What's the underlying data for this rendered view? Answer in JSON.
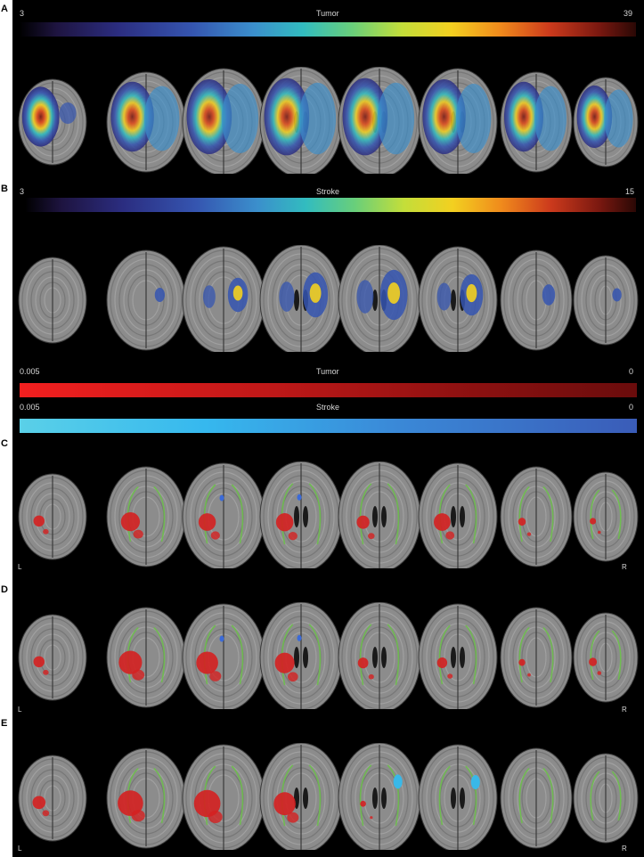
{
  "panels": {
    "a": {
      "letter": "A",
      "scale_min": "3",
      "scale_title": "Tumor",
      "scale_max": "39"
    },
    "b": {
      "letter": "B",
      "scale_min": "3",
      "scale_title": "Stroke",
      "scale_max": "15"
    },
    "c_legend": {
      "tumor": {
        "scale_min": "0.005",
        "scale_title": "Tumor",
        "scale_max": "0"
      },
      "stroke": {
        "scale_min": "0.005",
        "scale_title": "Stroke",
        "scale_max": "0"
      }
    },
    "c": {
      "letter": "C",
      "left": "L",
      "right": "R"
    },
    "d": {
      "letter": "D",
      "left": "L",
      "right": "R"
    },
    "e": {
      "letter": "E",
      "left": "L",
      "right": "R"
    }
  },
  "colors": {
    "background": "#000000",
    "tumor_overlay": "#d42020",
    "stroke_overlay": "#39b8e8",
    "tract_outline": "#6bbf4a"
  }
}
